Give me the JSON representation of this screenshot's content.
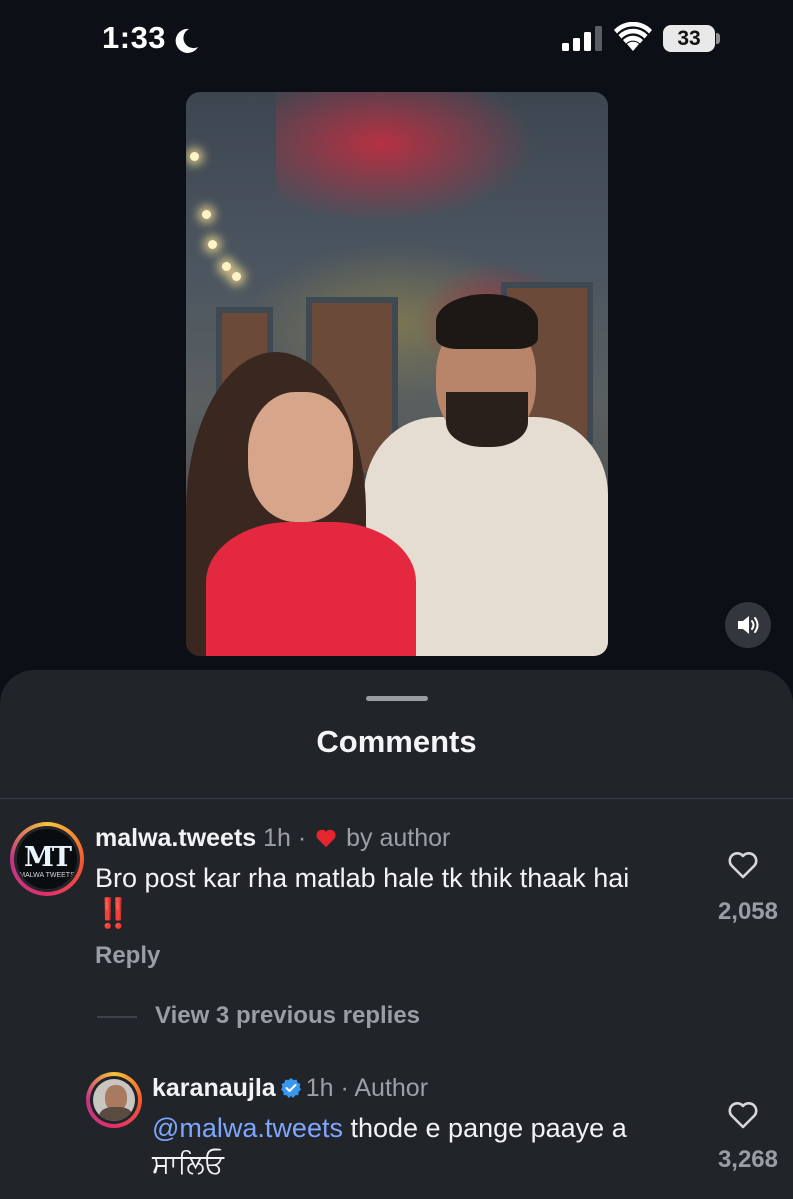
{
  "status_bar": {
    "time": "1:33",
    "battery_level": "33",
    "icons": [
      "moon-icon",
      "signal-icon",
      "wifi-icon",
      "battery-icon"
    ]
  },
  "media": {
    "icons": [
      "volume-icon"
    ]
  },
  "comments_sheet": {
    "title": "Comments",
    "comments": [
      {
        "username": "malwa.tweets",
        "time": "1h",
        "separator": "·",
        "liked_by": "by author",
        "text": "Bro post kar rha matlab hale tk thik thaak hai",
        "emoji": "‼️",
        "likes": "2,058",
        "reply_label": "Reply",
        "avatar_logo": "MT",
        "avatar_caption": "MALWA TWEETS"
      },
      {
        "username": "karanaujla",
        "verified": true,
        "time": "1h",
        "separator": "·",
        "role": "Author",
        "mention": "@malwa.tweets",
        "text": " thode e pange paaye a",
        "text_line2": "ਸਾਲਿਓ",
        "likes": "3,268"
      }
    ],
    "view_replies_label": "View 3 previous replies"
  },
  "colors": {
    "background": "#0c1016",
    "sheet": "#212428",
    "mention": "#7ea6ff",
    "heart": "#e5262f",
    "verified": "#3897f0"
  }
}
